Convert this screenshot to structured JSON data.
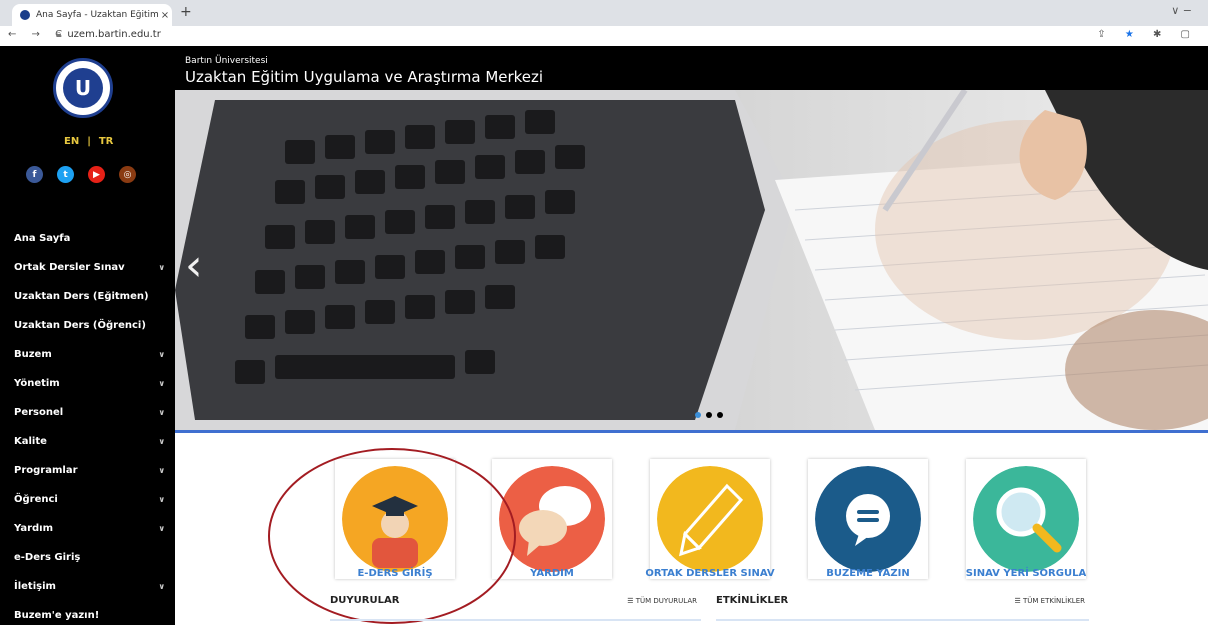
{
  "browser": {
    "tab_title": "Ana Sayfa - Uzaktan Eğitim Uygu",
    "tab_close": "×",
    "new_tab": "+",
    "url": "uzem.bartin.edu.tr",
    "nav_icons": "← → C",
    "window_controls": "∨  −",
    "tool_icons": [
      "⇪",
      "★",
      "✱",
      "▢"
    ]
  },
  "sidebar": {
    "logo_letter": "U",
    "lang": {
      "en": "EN",
      "sep": "|",
      "tr": "TR"
    },
    "social": [
      {
        "icon": "facebook-icon",
        "glyph": "f",
        "color": "#3b5998"
      },
      {
        "icon": "twitter-icon",
        "glyph": "t",
        "color": "#1da1f2"
      },
      {
        "icon": "youtube-icon",
        "glyph": "▶",
        "color": "#e62117"
      },
      {
        "icon": "instagram-icon",
        "glyph": "◎",
        "color": "#8a3b12"
      }
    ],
    "menu": [
      {
        "label": "Ana Sayfa",
        "chevron": false
      },
      {
        "label": "Ortak Dersler Sınav",
        "chevron": true
      },
      {
        "label": "Uzaktan Ders (Eğitmen)",
        "chevron": false
      },
      {
        "label": "Uzaktan Ders (Öğrenci)",
        "chevron": false
      },
      {
        "label": "Buzem",
        "chevron": true
      },
      {
        "label": "Yönetim",
        "chevron": true
      },
      {
        "label": "Personel",
        "chevron": true
      },
      {
        "label": "Kalite",
        "chevron": true
      },
      {
        "label": "Programlar",
        "chevron": true
      },
      {
        "label": "Öğrenci",
        "chevron": true
      },
      {
        "label": "Yardım",
        "chevron": true
      },
      {
        "label": "e-Ders Giriş",
        "chevron": false
      },
      {
        "label": "İletişim",
        "chevron": true
      },
      {
        "label": "Buzem'e yazın!",
        "chevron": false
      }
    ]
  },
  "header": {
    "subtitle": "Bartın Üniversitesi",
    "title": "Uzaktan Eğitim Uygulama ve Araştırma Merkezi"
  },
  "hero": {
    "prev_arrow": "‹",
    "active_dot": 0,
    "dot_count": 3
  },
  "cards": [
    {
      "label": "E-DERS GİRİŞ",
      "icon": "student-graduate-icon",
      "color": "#f5a623"
    },
    {
      "label": "YARDIM",
      "icon": "speech-bubbles-icon",
      "color": "#ec5f45"
    },
    {
      "label": "ORTAK DERSLER SINAV",
      "icon": "pencil-icon",
      "color": "#f2b81e"
    },
    {
      "label": "BUZEME YAZIN",
      "icon": "message-icon",
      "color": "#1b5b8a"
    },
    {
      "label": "SINAV YERİ SORGULA",
      "icon": "magnifier-icon",
      "color": "#3bb79a"
    }
  ],
  "sections": {
    "news": {
      "title": "DUYURULAR",
      "link": "☰ TÜM DUYURULAR"
    },
    "events": {
      "title": "ETKİNLİKLER",
      "link": "☰ TÜM ETKİNLİKLER"
    }
  },
  "colors": {
    "accent": "#3b7fd0",
    "annotation": "#a31c22",
    "sidebar": "#000000"
  }
}
